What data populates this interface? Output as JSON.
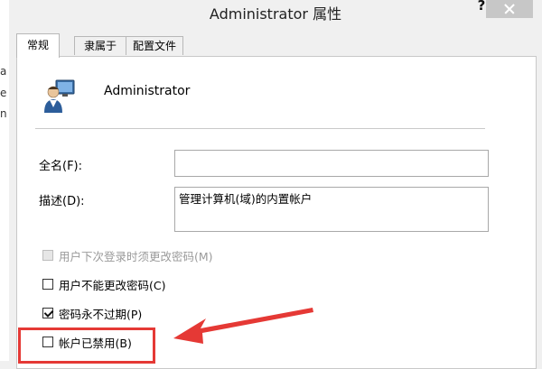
{
  "background": {
    "letters": [
      "a",
      "e",
      "n"
    ]
  },
  "dialog": {
    "title": "Administrator 属性",
    "help_label": "?"
  },
  "tabs": [
    {
      "label": "常规",
      "active": true
    },
    {
      "label": "隶属于",
      "active": false
    },
    {
      "label": "配置文件",
      "active": false
    }
  ],
  "general": {
    "username": "Administrator",
    "fullname_label": "全名(F):",
    "fullname_value": "",
    "description_label": "描述(D):",
    "description_value": "管理计算机(域)的内置帐户"
  },
  "options": [
    {
      "label": "用户下次登录时须更改密码(M)",
      "checked": false,
      "disabled": true
    },
    {
      "label": "用户不能更改密码(C)",
      "checked": false,
      "disabled": false
    },
    {
      "label": "密码永不过期(P)",
      "checked": true,
      "disabled": false
    },
    {
      "label": "帐户已禁用(B)",
      "checked": false,
      "disabled": false
    }
  ],
  "annotation": {
    "color": "#e53935"
  }
}
